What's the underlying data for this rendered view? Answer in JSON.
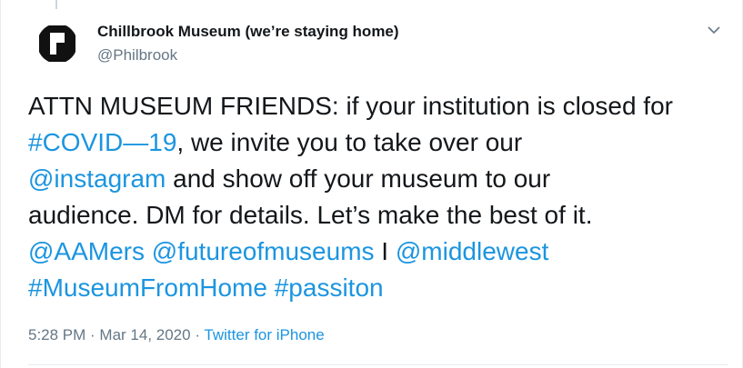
{
  "tweet": {
    "author": {
      "display_name": "Chillbrook Museum (we’re staying home)",
      "handle": "@Philbrook",
      "avatar_icon": "museum-logo-icon"
    },
    "menu_icon": "chevron-down-icon",
    "text_lines": [
      [
        {
          "text": "ATTN MUSEUM FRIENDS: if your institution is closed for",
          "type": "text"
        }
      ],
      [
        {
          "text": "#COVID—19",
          "type": "hashtag"
        },
        {
          "text": ", we invite you to take over our",
          "type": "text"
        }
      ],
      [
        {
          "text": "@instagram",
          "type": "mention"
        },
        {
          "text": " and show off your museum to our",
          "type": "text"
        }
      ],
      [
        {
          "text": "audience. DM for details. Let’s make the best of it.",
          "type": "text"
        }
      ],
      [
        {
          "text": "@AAMers",
          "type": "mention"
        },
        {
          "text": " ",
          "type": "text"
        },
        {
          "text": "@futureofmuseums",
          "type": "mention"
        },
        {
          "text": " I ",
          "type": "text"
        },
        {
          "text": "@middlewest",
          "type": "mention"
        }
      ],
      [
        {
          "text": "#MuseumFromHome",
          "type": "hashtag"
        },
        {
          "text": " ",
          "type": "text"
        },
        {
          "text": "#passiton",
          "type": "hashtag"
        }
      ]
    ],
    "time": "5:28 PM",
    "separator": " · ",
    "date": "Mar 14, 2020",
    "source": "Twitter for iPhone"
  },
  "colors": {
    "link": "#1b95e0",
    "text": "#14171a",
    "muted": "#657786"
  }
}
